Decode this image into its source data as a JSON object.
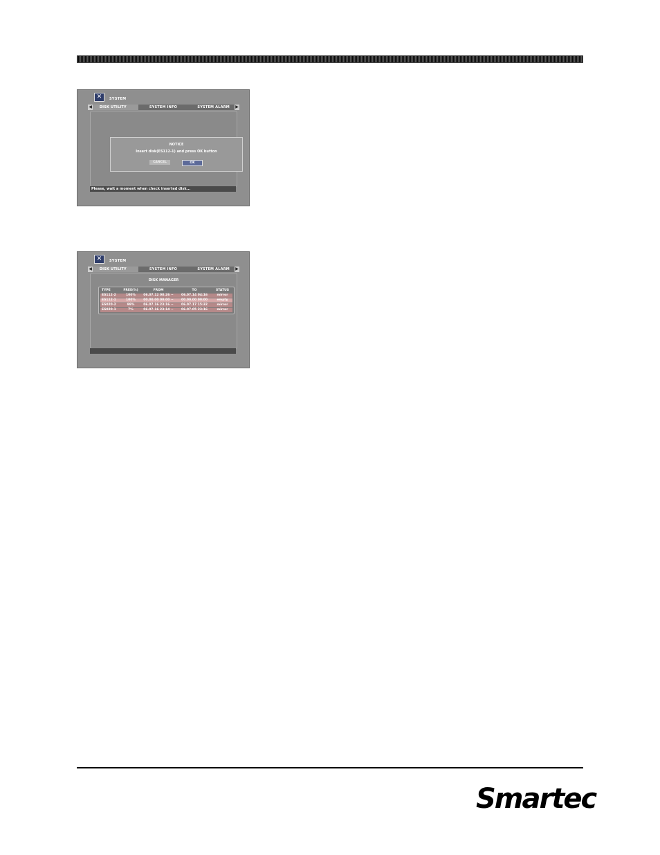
{
  "screen1": {
    "system_title": "SYSTEM",
    "tabs": [
      {
        "label": "DISK UTILITY"
      },
      {
        "label": "SYSTEM INFO"
      },
      {
        "label": "SYSTEM ALARM"
      }
    ],
    "notice": {
      "title": "NOTICE",
      "message": "Insert disk(ES112-1) and press OK button",
      "cancel_label": "CANCEL",
      "ok_label": "OK"
    },
    "status": "Please, wait a moment when check inserted disk..."
  },
  "screen2": {
    "system_title": "SYSTEM",
    "tabs": [
      {
        "label": "DISK UTILITY"
      },
      {
        "label": "SYSTEM INFO"
      },
      {
        "label": "SYSTEM ALARM"
      }
    ],
    "disk_manager_title": "DISK MANAGER",
    "columns": [
      "TYPE",
      "FREE(%)",
      "FROM",
      "TO",
      "STATUS"
    ],
    "rows": [
      {
        "type": "ES112-2",
        "free": "100%",
        "from": "06.07.12 08:26 ~",
        "to": "06.07.14 04:16",
        "status": "mirror"
      },
      {
        "type": "ES112-1",
        "free": "100%",
        "from": "00.00.00 00:00 ~",
        "to": "00.00.00 00:00",
        "status": "empty"
      },
      {
        "type": "ES020-2",
        "free": "99%",
        "from": "06.07.16 23:16 ~",
        "to": "06.07.17 15:32",
        "status": "mirror"
      },
      {
        "type": "ES020-1",
        "free": "7%",
        "from": "06.07.16 23:14 ~",
        "to": "06.07.05 23:16",
        "status": "mirror"
      }
    ]
  },
  "logo_text": "Smartec"
}
